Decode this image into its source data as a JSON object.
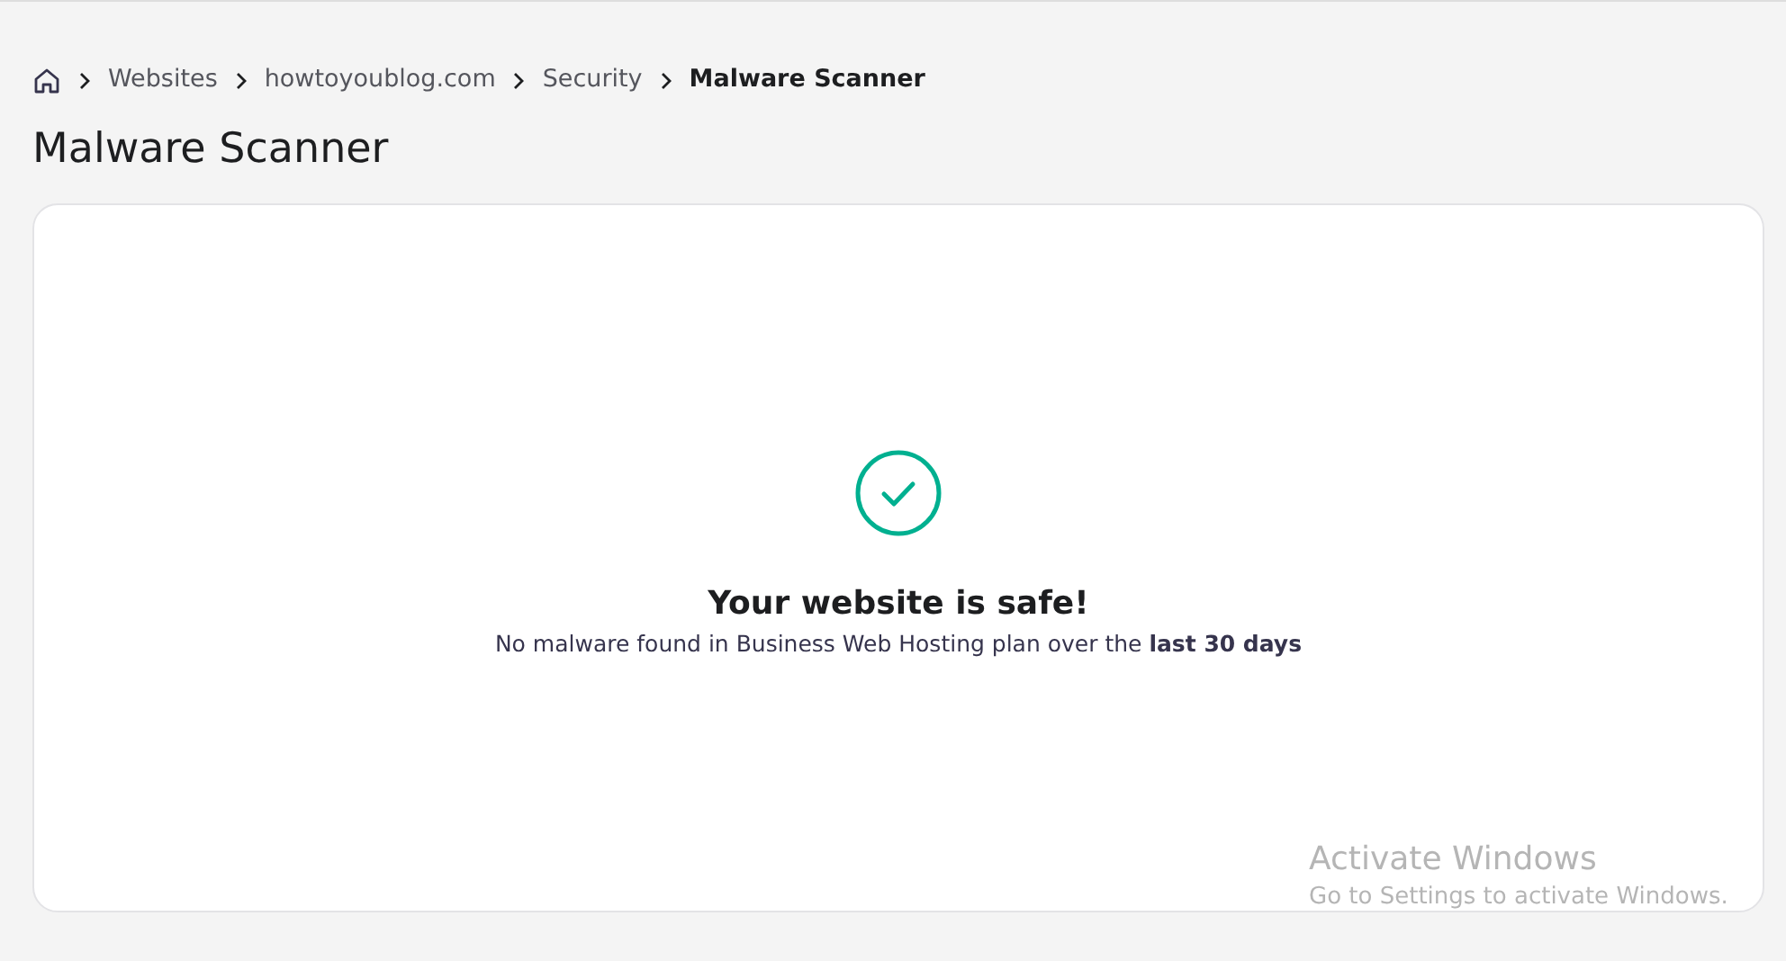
{
  "breadcrumb": [
    {
      "kind": "home"
    },
    {
      "kind": "link",
      "label": "Websites"
    },
    {
      "kind": "link",
      "label": "howtoyoublog.com"
    },
    {
      "kind": "link",
      "label": "Security"
    },
    {
      "kind": "current",
      "label": "Malware Scanner"
    }
  ],
  "page_title": "Malware Scanner",
  "status": {
    "title": "Your website is safe!",
    "message": "No malware found in Business Web Hosting plan over the **last 30 days**"
  },
  "os_notice": {
    "title": "Activate Windows",
    "message": "Go to Settings to activate Windows."
  }
}
